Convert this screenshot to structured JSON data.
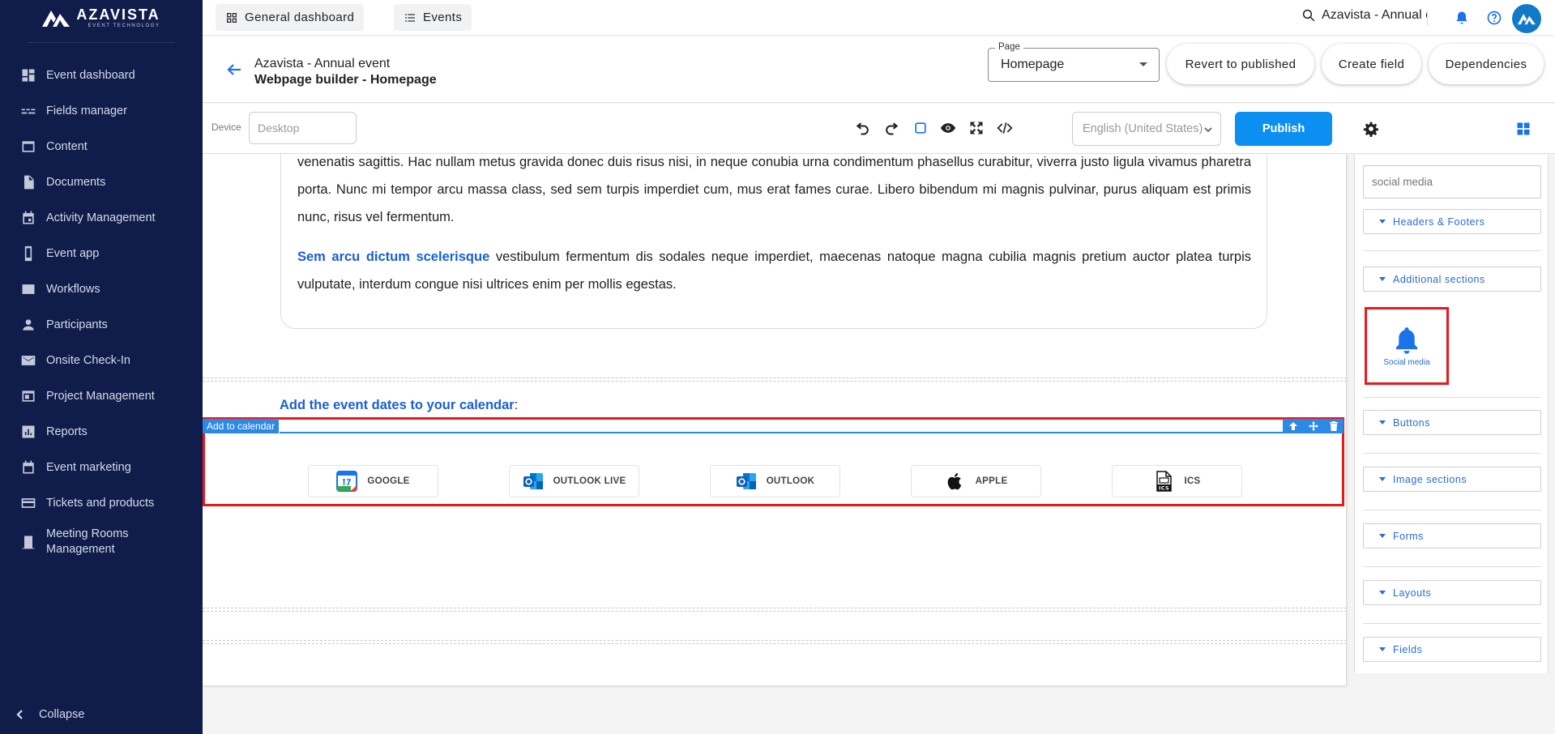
{
  "brand": {
    "name": "AZAVISTA",
    "tagline": "EVENT TECHNOLOGY"
  },
  "sidebar": {
    "items": [
      {
        "label": "Event dashboard",
        "icon": "dashboard-icon"
      },
      {
        "label": "Fields manager",
        "icon": "fields-icon"
      },
      {
        "label": "Content",
        "icon": "content-icon"
      },
      {
        "label": "Documents",
        "icon": "document-icon"
      },
      {
        "label": "Activity Management",
        "icon": "calendar-icon"
      },
      {
        "label": "Event app",
        "icon": "phone-icon"
      },
      {
        "label": "Workflows",
        "icon": "workflow-icon"
      },
      {
        "label": "Participants",
        "icon": "person-icon"
      },
      {
        "label": "Onsite Check-In",
        "icon": "mail-icon"
      },
      {
        "label": "Project Management",
        "icon": "project-icon"
      },
      {
        "label": "Reports",
        "icon": "reports-icon"
      },
      {
        "label": "Event marketing",
        "icon": "calendar-icon"
      },
      {
        "label": "Tickets and products",
        "icon": "card-icon"
      },
      {
        "label": "Meeting Rooms Management",
        "icon": "door-icon"
      }
    ],
    "collapse_label": "Collapse"
  },
  "topbar": {
    "tabs": [
      {
        "label": "General dashboard",
        "icon": "dashboard-icon"
      },
      {
        "label": "Events",
        "icon": "list-icon"
      }
    ],
    "search_text": "Azavista - Annual event"
  },
  "header": {
    "event_name": "Azavista - Annual event",
    "title": "Webpage builder - Homepage",
    "page_select": {
      "legend": "Page",
      "value": "Homepage"
    },
    "buttons": {
      "revert": "Revert to published",
      "create_field": "Create field",
      "dependencies": "Dependencies"
    }
  },
  "toolbar": {
    "device_label": "Device",
    "device_placeholder": "Desktop",
    "language": "English (United States)",
    "publish": "Publish"
  },
  "canvas": {
    "paragraph1": "venenatis sagittis. Hac nullam metus gravida donec duis risus nisi, in neque conubia urna condimentum phasellus curabitur, viverra justo ligula vivamus pharetra porta. Nunc mi tempor arcu massa class, sed sem turpis imperdiet cum, mus erat fames curae. Libero bibendum mi magnis pulvinar, purus aliquam est primis nunc, risus vel fermentum.",
    "paragraph2_highlight": "Sem arcu dictum scelerisque",
    "paragraph2_rest": " vestibulum fermentum dis sodales neque imperdiet, maecenas natoque magna cubilia magnis pretium auctor platea turpis vulputate, interdum congue nisi ultrices enim per mollis egestas.",
    "calendar_heading": "Add the event dates to your calendar",
    "calendar_heading_colon": ":",
    "selected_block_tag": "Add to calendar",
    "calendar_buttons": [
      {
        "label": "GOOGLE",
        "icon": "google-calendar-icon"
      },
      {
        "label": "OUTLOOK LIVE",
        "icon": "outlook-icon"
      },
      {
        "label": "OUTLOOK",
        "icon": "outlook-icon"
      },
      {
        "label": "APPLE",
        "icon": "apple-icon"
      },
      {
        "label": "ICS",
        "icon": "ics-file-icon"
      }
    ]
  },
  "panel": {
    "search_value": "social media",
    "sections": [
      "Headers & Footers",
      "Additional sections",
      "Buttons",
      "Image sections",
      "Forms",
      "Layouts",
      "Fields"
    ],
    "social_block_label": "Social media"
  },
  "colors": {
    "sidebar_bg": "#101c4a",
    "accent": "#0b8ff0",
    "link_blue": "#1a5fd6",
    "selection_red": "#e8191a"
  }
}
